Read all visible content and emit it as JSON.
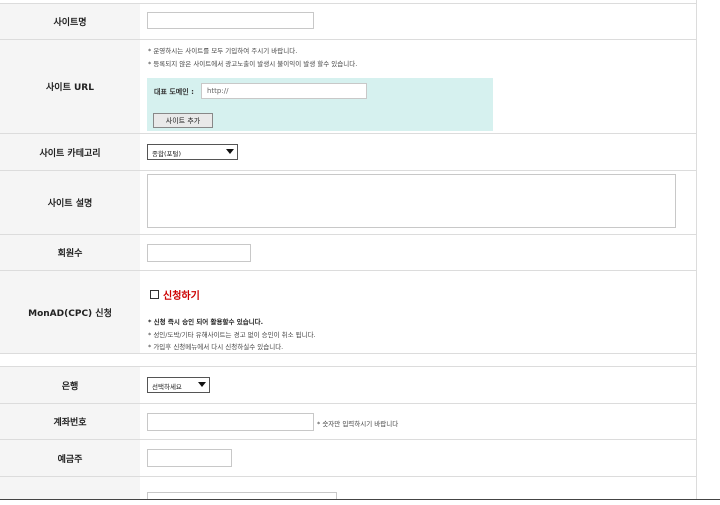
{
  "site_name": {
    "label": "사이트명"
  },
  "site_url": {
    "label": "사이트 URL",
    "notes": [
      "* 운영하시는 사이트를 모두 기입하여 주시기 바랍니다.",
      "* 등록되지 않은 사이트에서 광고노출이 발생시 불이익이 발생 할수 있습니다."
    ],
    "domain_label": "대표 도메인 :",
    "domain_value": "http://",
    "add_button": "사이트 추가"
  },
  "site_category": {
    "label": "사이트 카테고리",
    "selected": "종합(포털)"
  },
  "site_description": {
    "label": "사이트 설명"
  },
  "members": {
    "label": "회원수"
  },
  "monad": {
    "label": "MonAD(CPC) 신청",
    "apply_label": "신청하기",
    "apply_color": "#cc0000",
    "notes": [
      "* 신청 즉시 승인 되어 활용할수 있습니다.",
      "* 성인/도박/기타 유해사이트는 경고 없이 승인이 취소 됩니다.",
      "* 가입후 신청메뉴에서 다시 신청하실수 있습니다."
    ]
  },
  "bank": {
    "label": "은행",
    "selected": "선택하세요"
  },
  "account": {
    "label": "계좌번호",
    "note": "* 숫자만 입력하시기 바랍니다"
  },
  "holder": {
    "label": "예금주"
  }
}
